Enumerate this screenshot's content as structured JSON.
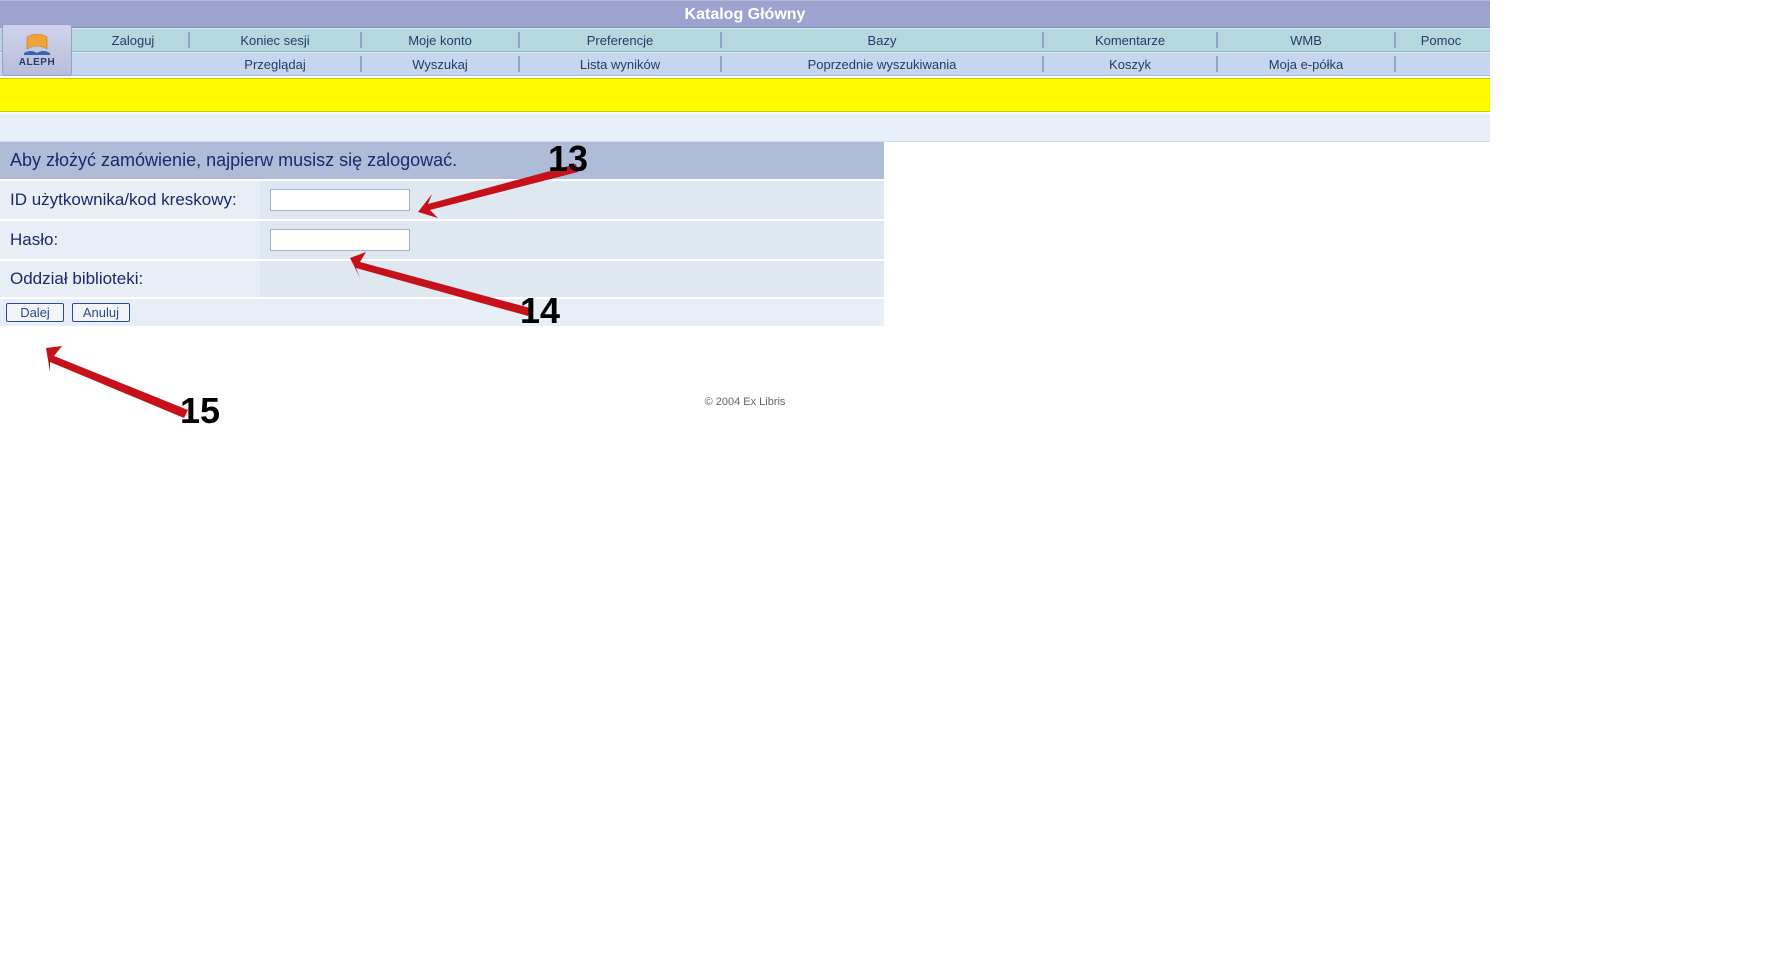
{
  "header": {
    "title": "Katalog Główny",
    "logo_text": "ALEPH"
  },
  "nav_row1": {
    "items": [
      "Zaloguj",
      "Koniec sesji",
      "Moje konto",
      "Preferencje",
      "Bazy",
      "Komentarze",
      "WMB",
      "Pomoc"
    ]
  },
  "nav_row2": {
    "items": [
      "Przeglądaj",
      "Wyszukaj",
      "Lista wyników",
      "Poprzednie wyszukiwania",
      "Koszyk",
      "Moja e-półka"
    ]
  },
  "login_form": {
    "prompt": "Aby złożyć zamówienie, najpierw musisz się zalogować.",
    "id_label": "ID użytkownika/kod kreskowy:",
    "id_value": "",
    "password_label": "Hasło:",
    "password_value": "",
    "branch_label": "Oddział biblioteki:",
    "branch_value": "",
    "submit_label": "Dalej",
    "cancel_label": "Anuluj"
  },
  "footer": {
    "copyright": "© 2004 Ex Libris"
  },
  "annotations": {
    "a13": "13",
    "a14": "14",
    "a15": "15"
  },
  "colors": {
    "title_bar": "#9da3cf",
    "nav1_bg": "#b5d8df",
    "nav2_bg": "#c6d6ee",
    "yellow": "#fffa00",
    "form_header": "#aebcd7",
    "form_cell": "#e8eef5",
    "arrow": "#c6101a"
  }
}
